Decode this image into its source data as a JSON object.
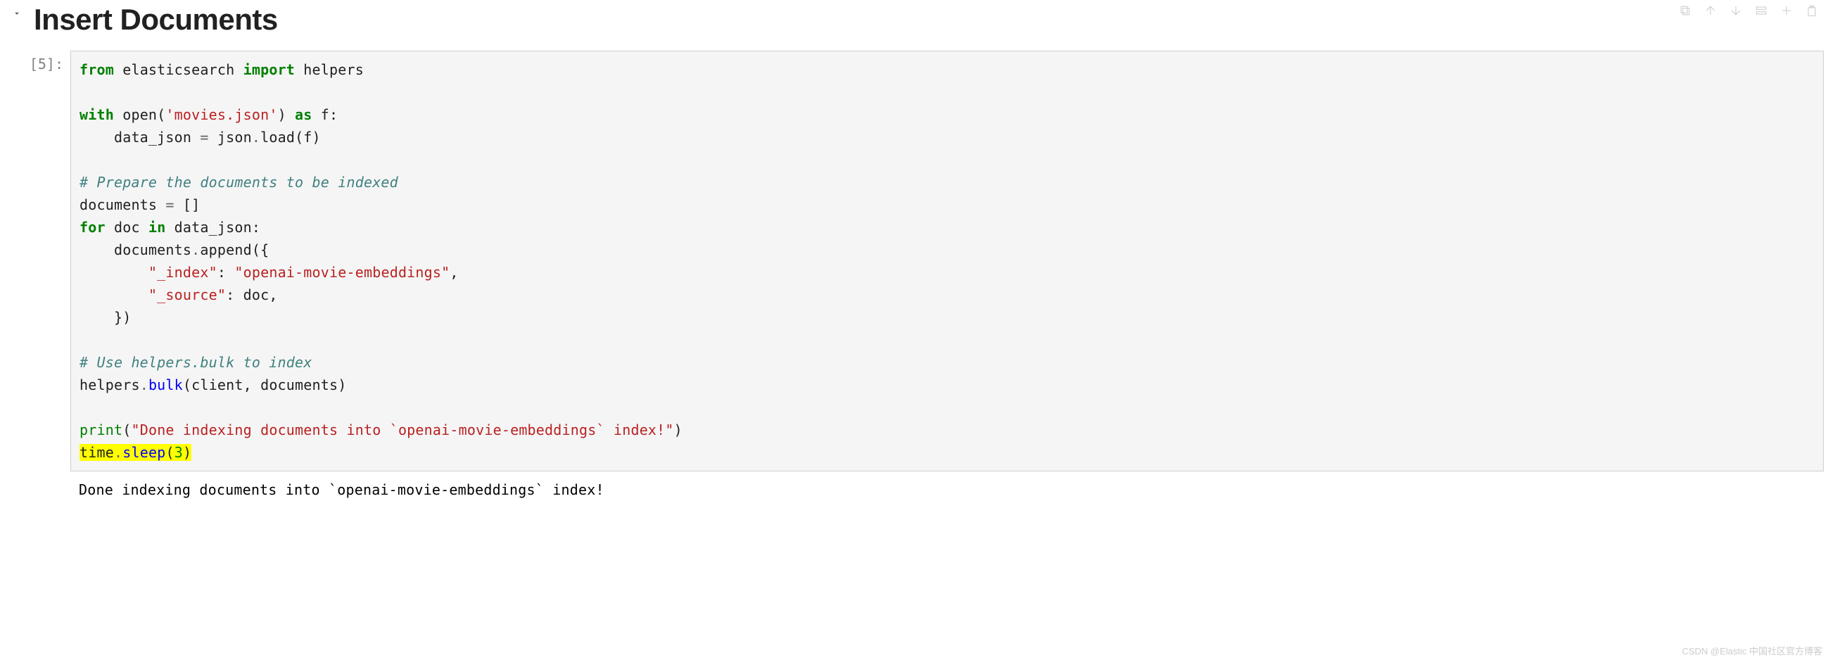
{
  "heading": "Insert Documents",
  "prompt_label": "[5]:",
  "code": {
    "line1_from": "from",
    "line1_mod": " elasticsearch ",
    "line1_import": "import",
    "line1_helpers": " helpers",
    "line3_with": "with",
    "line3_open": " open(",
    "line3_str": "'movies.json'",
    "line3_close": ") ",
    "line3_as": "as",
    "line3_f": " f:",
    "line4_pre": "    data_json ",
    "line4_eq": "=",
    "line4_post": " json",
    "line4_dot": ".",
    "line4_load": "load",
    "line4_paren": "(f)",
    "comment1": "# Prepare the documents to be indexed",
    "line6_docs": "documents ",
    "line6_eq": "=",
    "line6_empty": " []",
    "line7_for": "for",
    "line7_doc": " doc ",
    "line7_in": "in",
    "line7_dj": " data_json:",
    "line8_indent": "    documents",
    "line8_dot": ".",
    "line8_append": "append",
    "line8_paren": "({",
    "line9_indent": "        ",
    "line9_key": "\"_index\"",
    "line9_colon": ": ",
    "line9_val": "\"openai-movie-embeddings\"",
    "line9_comma": ",",
    "line10_indent": "        ",
    "line10_key": "\"_source\"",
    "line10_rest": ": doc,",
    "line11": "    })",
    "comment2": "# Use helpers.bulk to index",
    "line13_helpers": "helpers",
    "line13_dot": ".",
    "line13_bulk": "bulk",
    "line13_args": "(client, documents)",
    "line15_print": "print",
    "line15_open": "(",
    "line15_str": "\"Done indexing documents into `openai-movie-embeddings` index!\"",
    "line15_close": ")",
    "line16_time": "time",
    "line16_dot": ".",
    "line16_sleep": "sleep",
    "line16_open": "(",
    "line16_num": "3",
    "line16_close": ")"
  },
  "output": "Done indexing documents into `openai-movie-embeddings` index!",
  "watermark": "CSDN @Elastic 中国社区官方博客"
}
